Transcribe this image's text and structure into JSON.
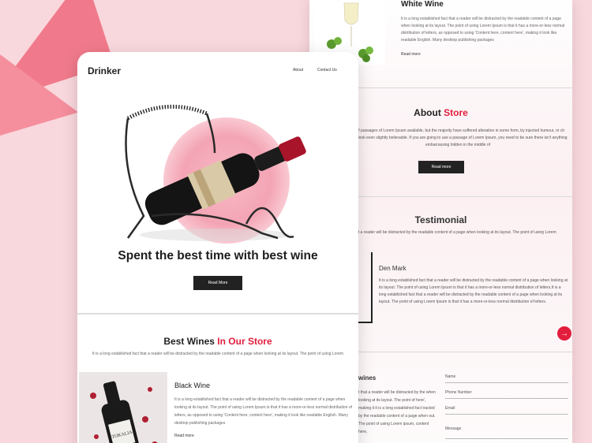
{
  "colors": {
    "accent": "#e21e3c",
    "background": "#f9d8dd",
    "button": "#222222"
  },
  "back": {
    "white_wine": {
      "title": "White Wine",
      "body": "It is a long established fact that a reader will be distracted by the readable content of a page when looking at its layout. The point of using Lorem Ipsum is that it has a more-or-less normal distribution of letters, as opposed to using 'Content here, content here', making it look like readable English. Many desktop publishing packages",
      "read_more": "Read more"
    },
    "about": {
      "title": "About",
      "title_accent": "Store",
      "body": "ns of passages of Lorem Ipsum available, but the majority have suffered alteration in some form, by injected humour, or ch don't look even slightly believable. If you are going to use a passage of Lorem Ipsum, you need to be sure there isn't anything embarrassing hidden in the middle of",
      "button": "Read more"
    },
    "testimonial": {
      "title": "Testimonial",
      "subtitle": "t that a reader will be distracted by the readable content of a page when looking at its layout. The point of using Lorem",
      "name": "Den Mark",
      "body": "It is a long established fact that a reader will be distracted by the readable content of a page when looking at its layout. The point of using Lorem Ipsum is that it has a more-or-less normal distribution of letters,It is a long established fact that a reader will be distracted by the readable content of a page when looking at its layout. The point of using Lorem Ipsum is that it has a more-or-less normal distribution of letters.",
      "next_icon": "arrow-right-icon"
    },
    "contact": {
      "left_title": "wines",
      "left_body": "t that a reader will be distracted by the when looking at its layout. The point of here', making it it is a long established fact tracted by the readable content of a page when out. The point of using Lorem ipsum, content here,",
      "fields": {
        "name": "Name",
        "phone": "Phone Number",
        "email": "Email",
        "message": "Message"
      }
    }
  },
  "front": {
    "logo": "Drinker",
    "nav": {
      "about": "About",
      "contact": "Contact Us"
    },
    "hero": {
      "title": "Spent the best time with best wine",
      "button": "Read More"
    },
    "best": {
      "title": "Best Wines",
      "title_accent": "In Our Store",
      "subtitle": "It is a long established fact that a reader will be distracted by the readable content of a page when looking at its layout. The point of using Lorem"
    },
    "black_wine": {
      "title": "Black Wine",
      "body": "It is a long established fact that a reader will be distracted by the readable content of a page when looking at its layout. The point of using Lorem Ipsum is that it has a more-or-less normal distribution of letters, as opposed to using 'Content here, content here', making it look like readable English. Many desktop publishing packages",
      "read_more": "Read more",
      "label_text": "TOKALIA"
    }
  }
}
